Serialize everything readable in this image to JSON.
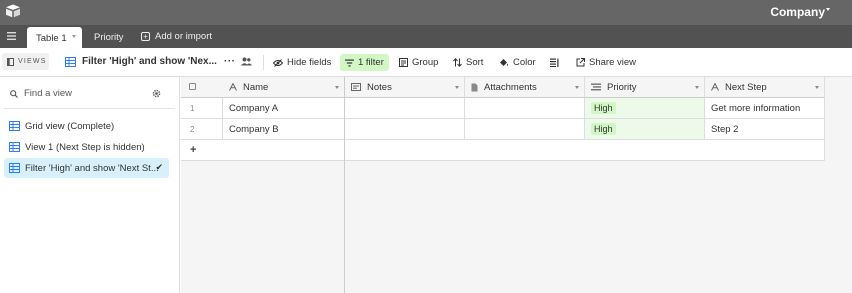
{
  "app": {
    "base_name": "Company",
    "colors": {
      "topbar": "#666666",
      "tabbar": "#525252",
      "filter_active": "#d1f7c4",
      "view_selected": "#d7f0fb",
      "priority_pill": "#d1f7c4"
    }
  },
  "tabs": {
    "active": "Table 1",
    "items": [
      "Priority"
    ],
    "add_import": "Add or import"
  },
  "toolbar": {
    "views_label": "VIEWS",
    "current_view": "Filter 'High' and show 'Nex...",
    "more": "···",
    "hide_fields": "Hide fields",
    "filter": "1 filter",
    "group": "Group",
    "sort": "Sort",
    "color": "Color",
    "share_view": "Share view"
  },
  "sidebar": {
    "search_placeholder": "Find a view",
    "views": [
      {
        "label": "Grid view (Complete)",
        "icon": "grid-icon",
        "selected": false
      },
      {
        "label": "View 1 (Next Step is hidden)",
        "icon": "grid-icon",
        "selected": false
      },
      {
        "label": "Filter 'High' and show 'Next St...",
        "icon": "grid-icon",
        "selected": true,
        "check": "✔"
      }
    ]
  },
  "grid": {
    "columns": [
      {
        "label": "Name",
        "icon": "text-field-icon"
      },
      {
        "label": "Notes",
        "icon": "long-text-icon"
      },
      {
        "label": "Attachments",
        "icon": "attachment-icon"
      },
      {
        "label": "Priority",
        "icon": "single-select-icon"
      },
      {
        "label": "Next Step",
        "icon": "text-field-icon"
      }
    ],
    "rows": [
      {
        "num": "1",
        "name": "Company A",
        "notes": "",
        "attachments": "",
        "priority": "High",
        "next_step": "Get more information"
      },
      {
        "num": "2",
        "name": "Company B",
        "notes": "",
        "attachments": "",
        "priority": "High",
        "next_step": "Step 2"
      }
    ],
    "add_row": "+"
  }
}
